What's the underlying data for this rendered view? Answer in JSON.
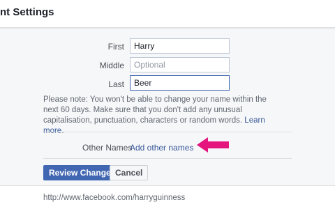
{
  "header": {
    "title": "nt Settings"
  },
  "form": {
    "first": {
      "label": "First",
      "value": "Harry",
      "placeholder": ""
    },
    "middle": {
      "label": "Middle",
      "value": "",
      "placeholder": "Optional"
    },
    "last": {
      "label": "Last",
      "value": "Beer",
      "placeholder": ""
    }
  },
  "note": {
    "strong": "Please note:",
    "text": " You won't be able to change your name within the next 60 days. Make sure that you don't add any unusual capitalisation, punctuation, characters or random words. ",
    "link": "Learn more",
    "end": "."
  },
  "other_names": {
    "label": "Other Names",
    "link": "Add other names"
  },
  "buttons": {
    "review": "Review Change",
    "cancel": "Cancel"
  },
  "footer": {
    "url": "http://www.facebook.com/harryguinness"
  },
  "colors": {
    "accent": "#4267b2",
    "link": "#365899",
    "arrow": "#e4157d"
  }
}
